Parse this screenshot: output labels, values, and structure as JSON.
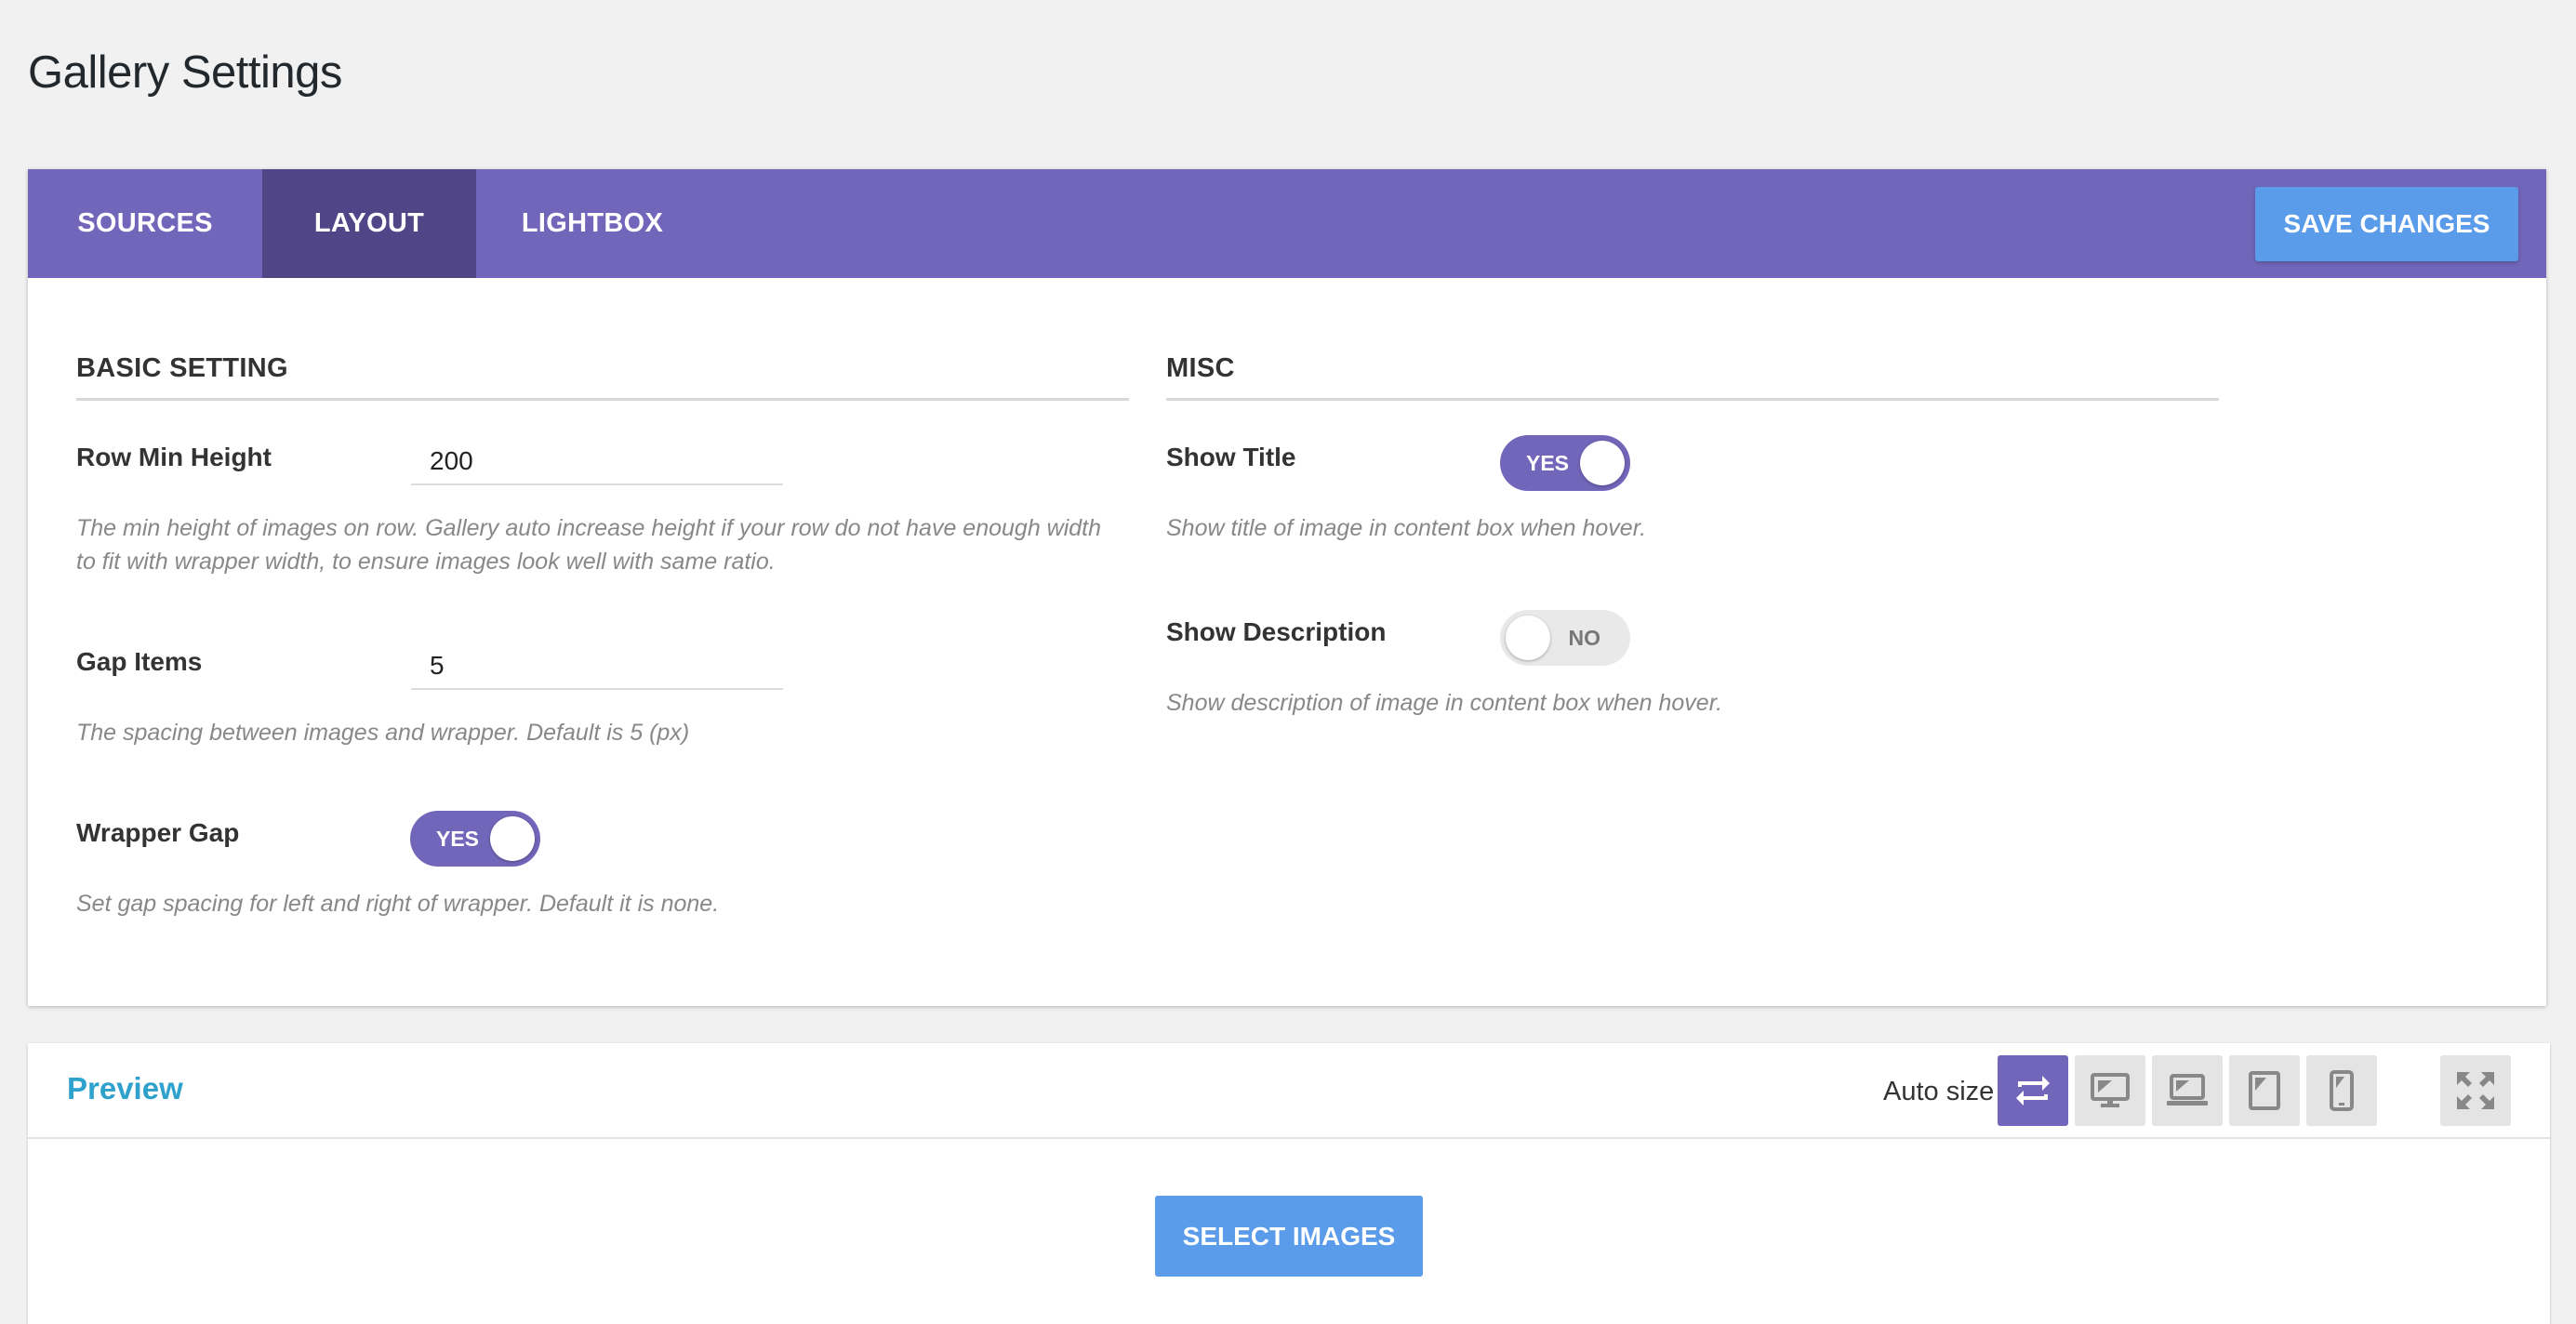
{
  "page": {
    "title": "Gallery Settings"
  },
  "tabs": [
    {
      "label": "SOURCES",
      "active": false
    },
    {
      "label": "LAYOUT",
      "active": true
    },
    {
      "label": "LIGHTBOX",
      "active": false
    }
  ],
  "toolbar": {
    "save_label": "SAVE CHANGES"
  },
  "basic": {
    "title": "BASIC SETTING",
    "row_min_height": {
      "label": "Row Min Height",
      "value": "200",
      "help_line1": "The min height of images on row. Gallery auto increase height if your row do not have enough width",
      "help_line2": "to fit with wrapper width, to ensure images look well with same ratio."
    },
    "gap_items": {
      "label": "Gap Items",
      "value": "5",
      "help": "The spacing between images and wrapper. Default is 5 (px)"
    },
    "wrapper_gap": {
      "label": "Wrapper Gap",
      "state": "YES",
      "help": "Set gap spacing for left and right of wrapper. Default it is none."
    }
  },
  "misc": {
    "title": "MISC",
    "show_title": {
      "label": "Show Title",
      "state": "YES",
      "help": "Show title of image in content box when hover."
    },
    "show_description": {
      "label": "Show Description",
      "state": "NO",
      "help": "Show description of image in content box when hover."
    }
  },
  "preview": {
    "title": "Preview",
    "auto_size_label": "Auto size",
    "devices": [
      {
        "icon": "auto-size-icon",
        "active": true
      },
      {
        "icon": "desktop-icon",
        "active": false
      },
      {
        "icon": "laptop-icon",
        "active": false
      },
      {
        "icon": "tablet-icon",
        "active": false
      },
      {
        "icon": "mobile-icon",
        "active": false
      }
    ],
    "fullscreen_icon": "fullscreen-icon",
    "select_label": "SELECT IMAGES"
  },
  "colors": {
    "accent": "#7266ba",
    "accent_dark": "#4f4587",
    "button_blue": "#5a9bea",
    "preview_title": "#2ea2cc"
  }
}
